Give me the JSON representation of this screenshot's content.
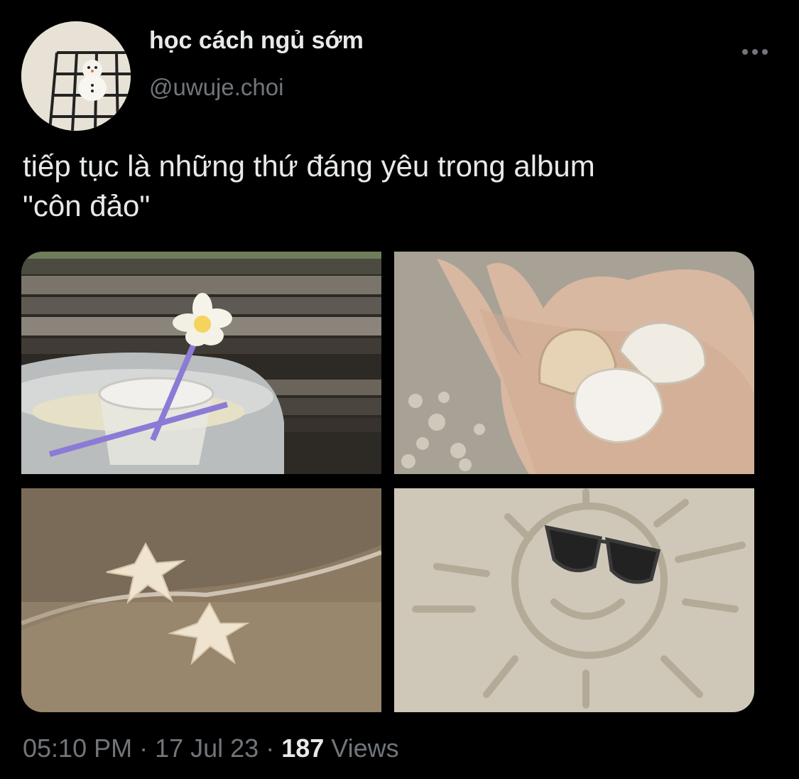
{
  "author": {
    "display_name": "học cách ngủ sớm",
    "handle": "@uwuje.choi"
  },
  "tweet": {
    "text": "tiếp tục là những thứ đáng yêu trong album\n\"côn đảo\""
  },
  "media": [
    {
      "subject": "purple straw drink with plumeria flower on wooden bench"
    },
    {
      "subject": "hand holding seashells over sand"
    },
    {
      "subject": "two starfish on wet sand"
    },
    {
      "subject": "sun drawn in sand wearing sunglasses"
    }
  ],
  "meta": {
    "time": "05:10 PM",
    "separator": "·",
    "date": "17 Jul 23",
    "views_count": "187",
    "views_label": "Views"
  },
  "icons": {
    "more": "more-horizontal-icon"
  }
}
